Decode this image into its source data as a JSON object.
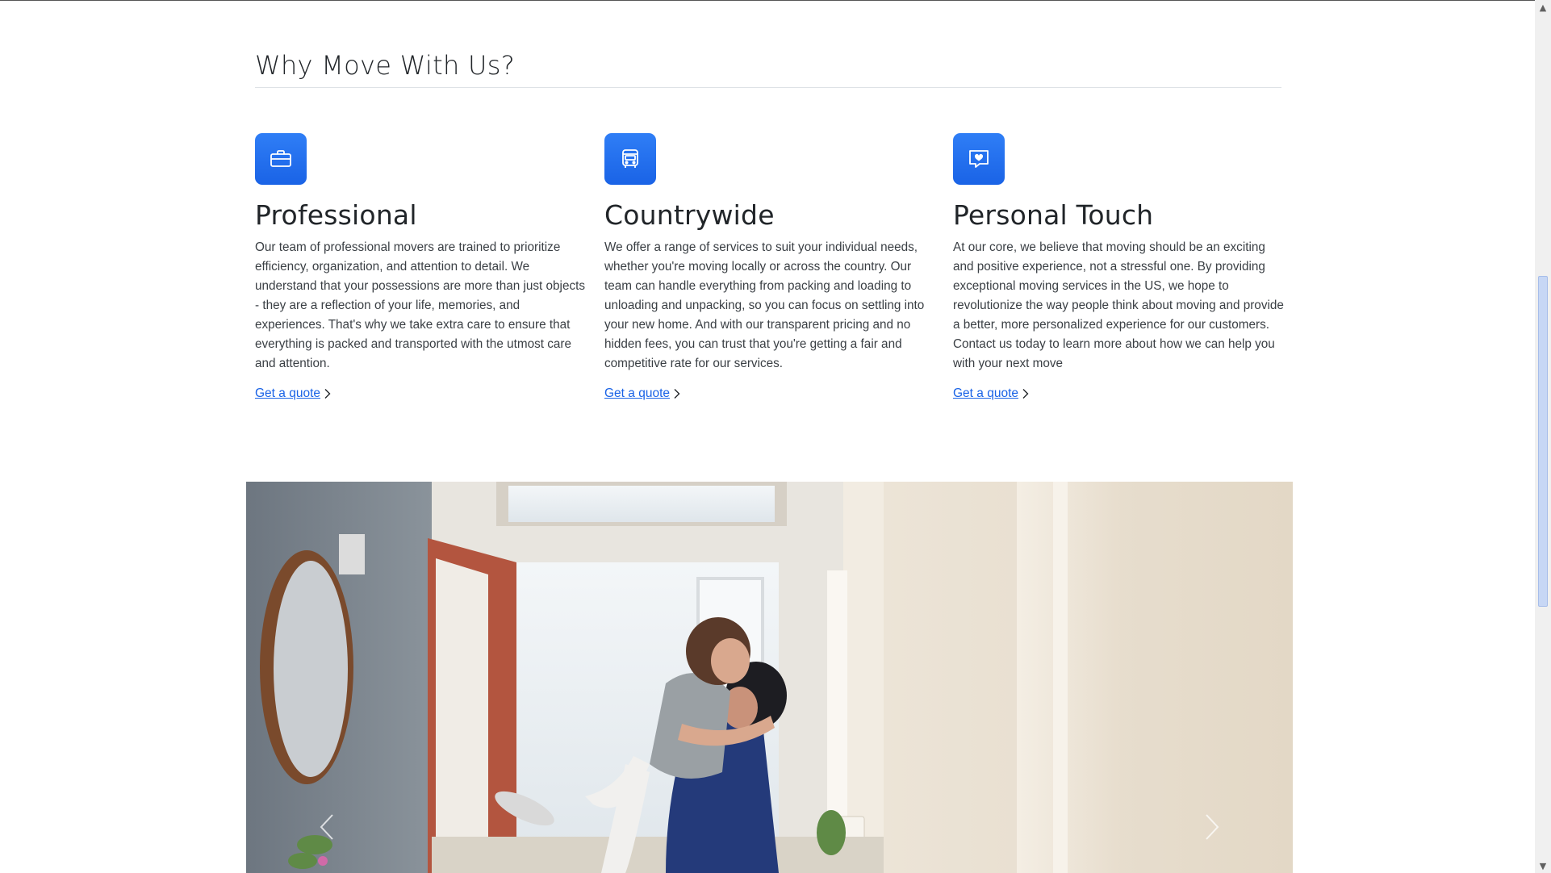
{
  "section": {
    "title": "Why Move With Us?"
  },
  "features": [
    {
      "icon": "briefcase-icon",
      "title": "Professional",
      "body": "Our team of professional movers are trained to prioritize efficiency, organization, and attention to detail. We understand that your possessions are more than just objects - they are a reflection of your life, memories, and experiences. That's why we take extra care to ensure that everything is packed and transported with the utmost care and attention.",
      "link": "Get a quote"
    },
    {
      "icon": "bus-icon",
      "title": "Countrywide",
      "body": "We offer a range of services to suit your individual needs, whether you're moving locally or across the country. Our team can handle everything from packing and loading to unloading and unpacking, so you can focus on settling into your new home. And with our transparent pricing and no hidden fees, you can trust that you're getting a fair and competitive rate for our services.",
      "link": "Get a quote"
    },
    {
      "icon": "chat-heart-icon",
      "title": "Personal Touch",
      "body": "At our core, we believe that moving should be an exciting and positive experience, not a stressful one. By providing exceptional moving services in the US, we hope to revolutionize the way people think about moving and provide a better, more personalized experience for our customers. Contact us today to learn more about how we can help you with your next move",
      "link": "Get a quote"
    }
  ],
  "colors": {
    "accent": "#1a63e6",
    "text": "#212529"
  }
}
